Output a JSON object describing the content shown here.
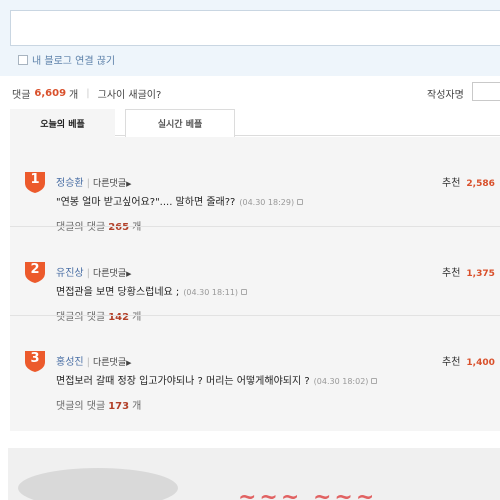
{
  "comment_form": {
    "disconnect_label": "내 블로그 연결 끊기"
  },
  "stats": {
    "comments_label": "댓글",
    "comments_count": "6,609",
    "comments_unit": "개",
    "new_since_label": "그사이 새글이?",
    "author_label": "작성자명"
  },
  "tabs": [
    {
      "label": "오늘의 베플",
      "active": true
    },
    {
      "label": "실시간 베플",
      "active": false
    }
  ],
  "comments": [
    {
      "rank": "1",
      "author": "정승환",
      "other_comments": "다른댓글",
      "recommend_label": "추천",
      "recommend_count": "2,586",
      "text": "\"연봉 얼마 받고싶어요?\".... 말하면 줄래??",
      "time": "(04.30 18:29)",
      "replies_label": "댓글의 댓글",
      "replies_count": "265",
      "replies_unit": "개"
    },
    {
      "rank": "2",
      "author": "유진상",
      "other_comments": "다른댓글",
      "recommend_label": "추천",
      "recommend_count": "1,375",
      "text": "면접관을 보면 당황스럽네요 ;",
      "time": "(04.30 18:11)",
      "replies_label": "댓글의 댓글",
      "replies_count": "142",
      "replies_unit": "개"
    },
    {
      "rank": "3",
      "author": "홍성진",
      "other_comments": "다른댓글",
      "recommend_label": "추천",
      "recommend_count": "1,400",
      "text": "면접보러 갈때 정장 입고가야되나 ? 머리는 어떻게해야되지 ?",
      "time": "(04.30 18:02)",
      "replies_label": "댓글의 댓글",
      "replies_count": "173",
      "replies_unit": "개"
    }
  ],
  "colors": {
    "rank_badge": "#ec5a2c",
    "count_accent": "#d9502b",
    "author_link": "#4a6fa5"
  }
}
